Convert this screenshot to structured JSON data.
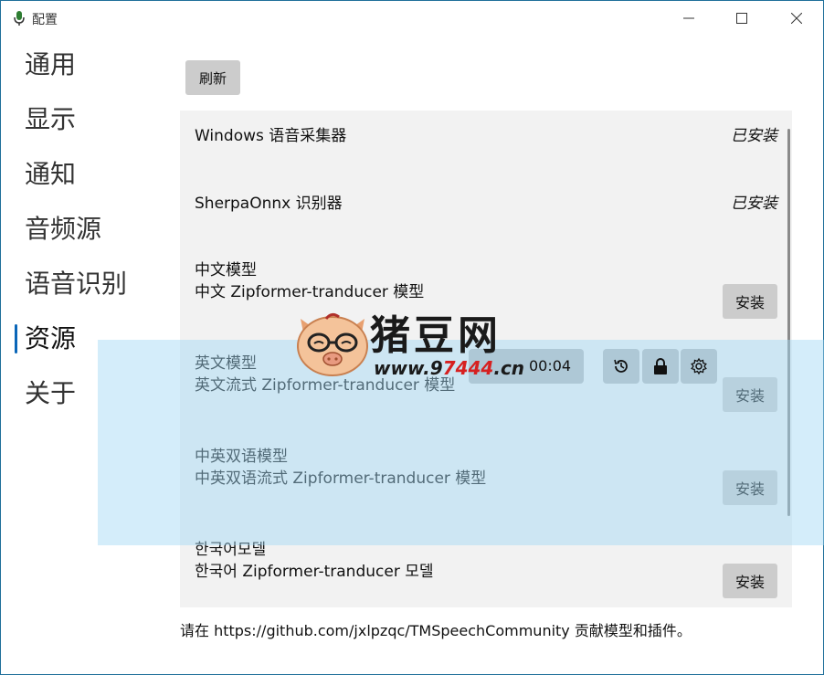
{
  "window": {
    "title": "配置",
    "icon": "microphone-icon"
  },
  "sidebar": {
    "items": [
      {
        "label": "通用"
      },
      {
        "label": "显示"
      },
      {
        "label": "通知"
      },
      {
        "label": "音频源"
      },
      {
        "label": "语音识别"
      },
      {
        "label": "资源"
      },
      {
        "label": "关于"
      }
    ],
    "active": "资源"
  },
  "toolbar": {
    "refresh_label": "刷新"
  },
  "resources": [
    {
      "title": "Windows 语音采集器",
      "status": "已安装"
    },
    {
      "title": "SherpaOnnx 识别器",
      "status": "已安装"
    },
    {
      "title": "中文模型",
      "subtitle": "中文 Zipformer-tranducer 模型",
      "action": "安装"
    },
    {
      "title": "英文模型",
      "subtitle": "英文流式 Zipformer-tranducer 模型",
      "action": "安装"
    },
    {
      "title": "中英双语模型",
      "subtitle": "中英双语流式 Zipformer-tranducer 模型",
      "action": "安装"
    },
    {
      "title": "한국어모델",
      "subtitle": "한국어 Zipformer-tranducer 모델",
      "action": "安装"
    }
  ],
  "footer": {
    "text": "请在 https://github.com/jxlpzqc/TMSpeechCommunity 贡献模型和插件。"
  },
  "overlay": {
    "timer": "00:04",
    "tools": [
      "history-icon",
      "lock-icon",
      "gear-icon"
    ]
  },
  "watermark": {
    "text": "猪豆网",
    "url_prefix": "www.9",
    "url_mid": "7444",
    "url_suffix": ".cn"
  },
  "colors": {
    "accent": "#0a66b8",
    "button_bg": "#cccccc",
    "list_bg": "#f2f2f2",
    "overlay": "#a0d7f5"
  }
}
